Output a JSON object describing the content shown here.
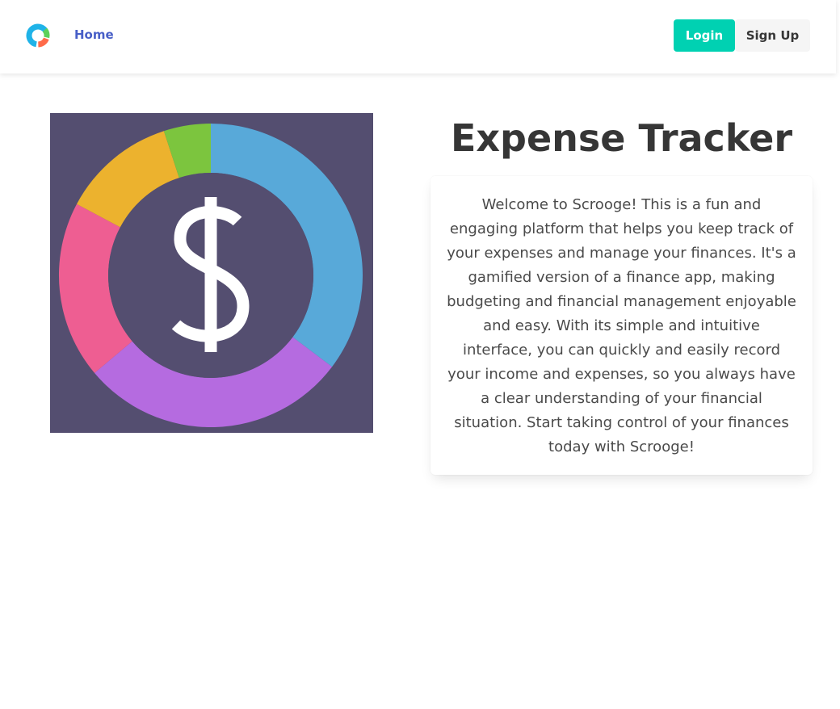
{
  "navbar": {
    "home_label": "Home",
    "login_label": "Login",
    "signup_label": "Sign Up"
  },
  "icons": {
    "logo": "ring-chart-logo-icon",
    "hero": "dollar-ring-chart-icon"
  },
  "colors": {
    "link": "#485fc7",
    "login_button": "#00d1b2",
    "signup_button": "#f5f5f5",
    "hero_background": "#544e70",
    "segment_blue": "#58a9d9",
    "segment_purple": "#b56be0",
    "segment_pink": "#ee5e92",
    "segment_yellow": "#ecb22e",
    "segment_green": "#7cc53e"
  },
  "main": {
    "title": "Expense Tracker",
    "description": "Welcome to Scrooge! This is a fun and engaging platform that helps you keep track of your expenses and manage your finances. It's a gamified version of a finance app, making budgeting and financial management enjoyable and easy. With its simple and intuitive interface, you can quickly and easily record your income and expenses, so you always have a clear understanding of your financial situation. Start taking control of your finances today with Scrooge!"
  }
}
